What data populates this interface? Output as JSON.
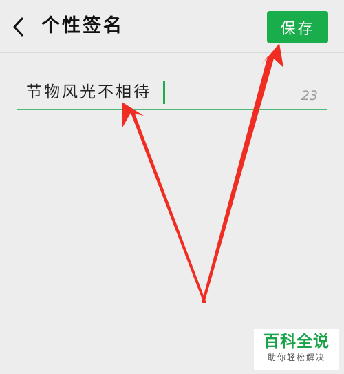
{
  "header": {
    "back_icon": "chevron-left-icon",
    "title": "个性签名",
    "save_label": "保存"
  },
  "signature": {
    "value": "节物风光不相待",
    "remaining_count": "23"
  },
  "watermark": {
    "title": "百科全说",
    "subtitle": "助你轻松解决"
  },
  "colors": {
    "accent": "#1aad4b",
    "underline": "#4dbb77",
    "background": "#ededed",
    "annotation_arrow": "#f02d23"
  }
}
